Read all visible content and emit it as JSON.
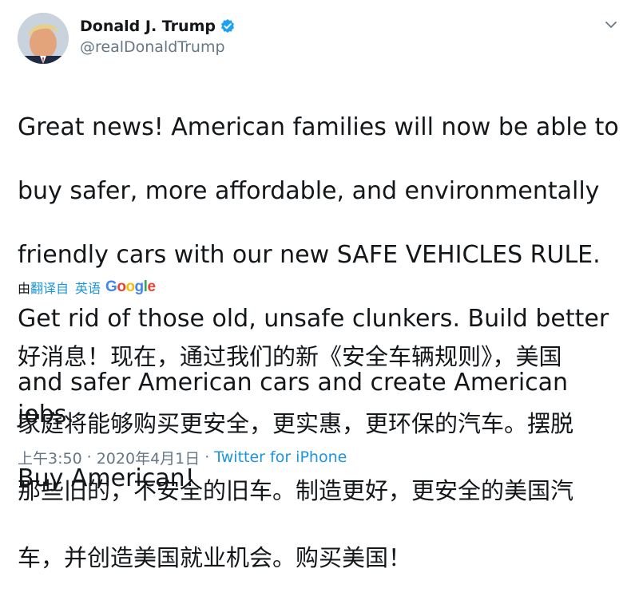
{
  "author": {
    "display_name": "Donald J. Trump",
    "handle": "@realDonaldTrump",
    "verified": true,
    "avatar_icon": "profile-avatar"
  },
  "tweet": {
    "text_lines": [
      "Great news! American families will now be able to",
      "buy safer, more affordable, and environmentally",
      "friendly cars with our new SAFE VEHICLES RULE.",
      "Get rid of those old, unsafe clunkers. Build better",
      "and safer American cars and create American jobs.",
      "Buy American!"
    ]
  },
  "translation": {
    "prefix": "由",
    "link": "翻译自",
    "language": "英语",
    "provider": "Google",
    "text_lines": [
      "好消息！现在，通过我们的新《安全车辆规则》，美国",
      "家庭将能够购买更安全，更实惠，更环保的汽车。摆脱",
      "那些旧的，不安全的旧车。制造更好，更安全的美国汽",
      "车，并创造美国就业机会。购买美国！"
    ]
  },
  "meta": {
    "time": "上午3:50",
    "separator": "·",
    "date": "2020年4月1日",
    "source": "Twitter for iPhone"
  },
  "colors": {
    "link": "#1b95e0",
    "secondary_text": "#657786",
    "verified_badge": "#1da1f2"
  },
  "icons": {
    "verified": "verified-badge-icon",
    "caret": "chevron-down-icon"
  }
}
